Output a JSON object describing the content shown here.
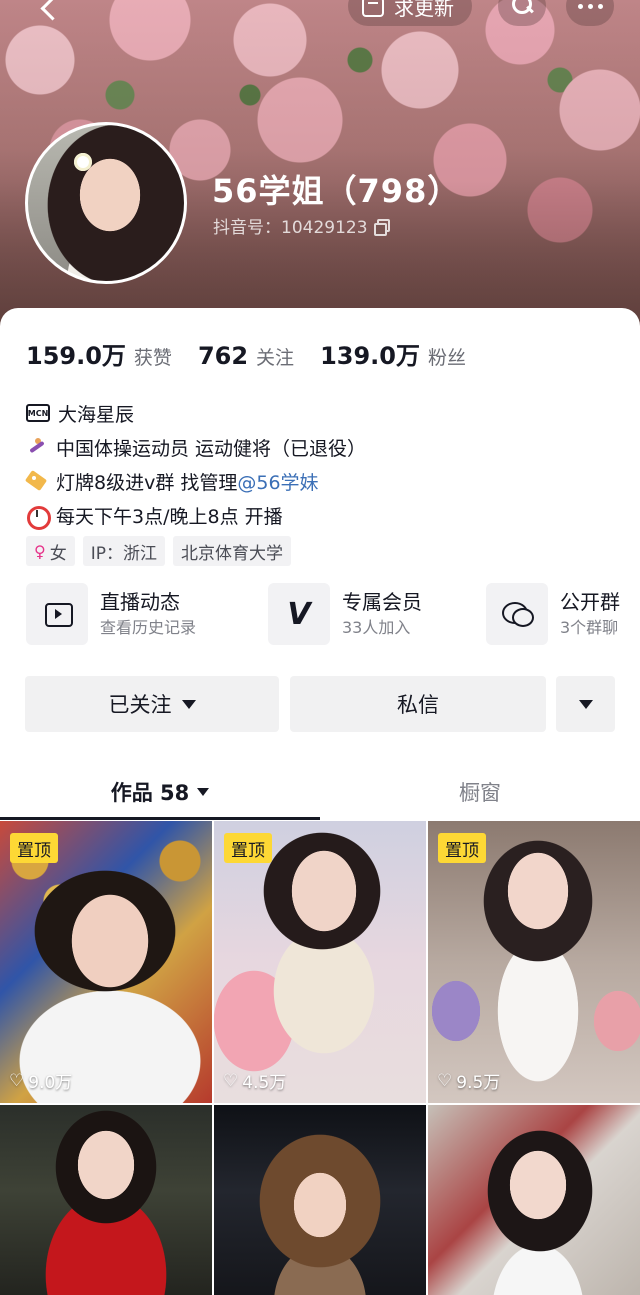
{
  "header": {
    "update_label": "求更新",
    "name": "56学姐（798）",
    "douyin_id": "抖音号：10429123"
  },
  "stats": [
    {
      "value": "159.0万",
      "label": "获赞"
    },
    {
      "value": "762",
      "label": "关注"
    },
    {
      "value": "139.0万",
      "label": "粉丝"
    }
  ],
  "bio": {
    "mcn_badge": "MCN",
    "mcn": "大海星辰",
    "line1": "中国体操运动员 运动健将（已退役）",
    "line2_text": "灯牌8级进v群 找管理",
    "line2_mention": "@56学妹",
    "line3": "每天下午3点/晚上8点 开播"
  },
  "chips": {
    "gender": "女",
    "ip": "IP：浙江",
    "school": "北京体育大学"
  },
  "features": [
    {
      "title": "直播动态",
      "sub": "查看历史记录",
      "icon": "tv-icon"
    },
    {
      "title": "专属会员",
      "sub": "33人加入",
      "icon": "v-icon"
    },
    {
      "title": "公开群",
      "sub": "3个群聊",
      "icon": "chat-icon"
    }
  ],
  "actions": {
    "follow": "已关注",
    "message": "私信"
  },
  "tabs": {
    "works": "作品 58",
    "shop": "橱窗"
  },
  "videos": [
    {
      "pinned": "置顶",
      "likes": "9.0万"
    },
    {
      "pinned": "置顶",
      "likes": "4.5万"
    },
    {
      "pinned": "置顶",
      "likes": "9.5万"
    },
    {
      "pinned": "",
      "likes": ""
    },
    {
      "pinned": "",
      "likes": ""
    },
    {
      "pinned": "",
      "likes": ""
    }
  ],
  "colors": {
    "pin_badge": "#fdd835",
    "mention": "#3b6fb6",
    "text_primary": "#161823",
    "text_secondary": "#80828a"
  }
}
